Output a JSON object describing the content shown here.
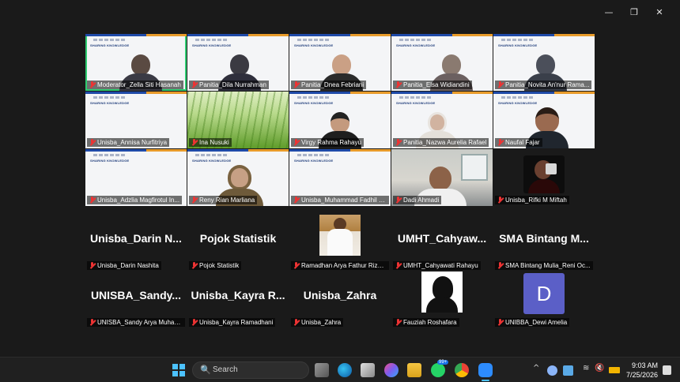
{
  "window": {
    "minimize": "—",
    "maximize": "❐",
    "close": "✕"
  },
  "participants": {
    "row1": [
      {
        "name": "Moderator_Zella Siti Hasanah",
        "slide_text": "SHARING KNOWLEDGE"
      },
      {
        "name": "Panitia_Dila Nurrahman",
        "slide_text": "SHARING KNOWLEDGE"
      },
      {
        "name": "Panitia_Dnea Febriani",
        "slide_text": "SHARING KNOWLEDGE"
      },
      {
        "name": "Panitia_Elsa Widiandini",
        "slide_text": "SHARING KNOWLEDGE"
      },
      {
        "name": "Panitia_Novita An'nur Rama...",
        "slide_text": "SHARING KNOWLEDGE"
      }
    ],
    "row2": [
      {
        "name": "Unisba_Annisa Nurfitriya",
        "slide_text": "SHARING KNOWLEDGE"
      },
      {
        "name": "Ina Nusuki"
      },
      {
        "name": "Virgy Rahma Rahayu",
        "slide_text": "SHARING KNOWLEDGE"
      },
      {
        "name": "Panitia_Nazwa Aurelia Rafael",
        "slide_text": "SHARING KNOWLEDGE"
      },
      {
        "name": "Naufal Fajar",
        "slide_text": "SHARING KNOWLEDGE"
      }
    ],
    "row3": [
      {
        "name": "Unisba_Adzlia Magfirotul In...",
        "slide_text": "SHARING KNOWLEDGE"
      },
      {
        "name": "Reny Rian Marliana",
        "slide_text": "SHARING KNOWLEDGE"
      },
      {
        "name": "Unisba_Muhammad Fadhil R...",
        "slide_text": "SHARING KNOWLEDGE"
      },
      {
        "name": "Dadi Ahmadi"
      },
      {
        "name": "Unisba_Rifki M Miftah"
      }
    ],
    "row4": [
      {
        "display": "Unisba_Darin  N...",
        "name": "Unisba_Darin Nashita"
      },
      {
        "display": "Pojok Statistik",
        "name": "Pojok Statistik"
      },
      {
        "display": "",
        "name": "Ramadhan Arya Fathur Rizky..."
      },
      {
        "display": "UMHT_Cahyaw...",
        "name": "UMHT_Cahyawati Rahayu"
      },
      {
        "display": "SMA Bintang M...",
        "name": "SMA Bintang Mulia_Reni Oc..."
      }
    ],
    "row5": [
      {
        "display": "UNISBA_Sandy...",
        "name": "UNISBA_Sandy Arya Muham..."
      },
      {
        "display": "Unisba_Kayra  R...",
        "name": "Unisba_Kayra Ramadhani"
      },
      {
        "display": "Unisba_Zahra",
        "name": "Unisba_Zahra"
      },
      {
        "display": "",
        "name": "Fauziah Roshafara"
      },
      {
        "display": "",
        "avatar_letter": "D",
        "name": "UNIBBA_Dewi Amelia"
      }
    ]
  },
  "taskbar": {
    "search_label": "Search",
    "search_icon": "🔍",
    "whatsapp_badge": "99+",
    "clock_time": "9:03 AM",
    "clock_date": "7/25/2026",
    "tray_chevron": "^",
    "wifi": "≋",
    "volume": "🔇"
  },
  "colors": {
    "accent": "#2ecc71",
    "avatar": "#5b5fc7",
    "muted_mic": "#ee3333"
  }
}
